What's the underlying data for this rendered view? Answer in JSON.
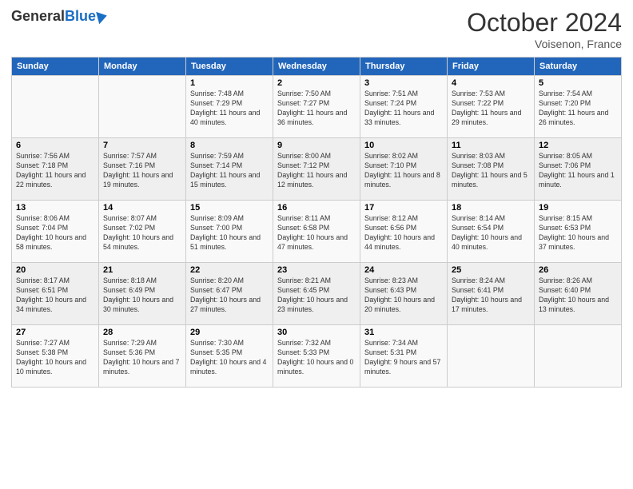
{
  "header": {
    "logo_general": "General",
    "logo_blue": "Blue",
    "month": "October 2024",
    "location": "Voisenon, France"
  },
  "days_of_week": [
    "Sunday",
    "Monday",
    "Tuesday",
    "Wednesday",
    "Thursday",
    "Friday",
    "Saturday"
  ],
  "weeks": [
    [
      {
        "day": "",
        "sunrise": "",
        "sunset": "",
        "daylight": ""
      },
      {
        "day": "",
        "sunrise": "",
        "sunset": "",
        "daylight": ""
      },
      {
        "day": "1",
        "sunrise": "Sunrise: 7:48 AM",
        "sunset": "Sunset: 7:29 PM",
        "daylight": "Daylight: 11 hours and 40 minutes."
      },
      {
        "day": "2",
        "sunrise": "Sunrise: 7:50 AM",
        "sunset": "Sunset: 7:27 PM",
        "daylight": "Daylight: 11 hours and 36 minutes."
      },
      {
        "day": "3",
        "sunrise": "Sunrise: 7:51 AM",
        "sunset": "Sunset: 7:24 PM",
        "daylight": "Daylight: 11 hours and 33 minutes."
      },
      {
        "day": "4",
        "sunrise": "Sunrise: 7:53 AM",
        "sunset": "Sunset: 7:22 PM",
        "daylight": "Daylight: 11 hours and 29 minutes."
      },
      {
        "day": "5",
        "sunrise": "Sunrise: 7:54 AM",
        "sunset": "Sunset: 7:20 PM",
        "daylight": "Daylight: 11 hours and 26 minutes."
      }
    ],
    [
      {
        "day": "6",
        "sunrise": "Sunrise: 7:56 AM",
        "sunset": "Sunset: 7:18 PM",
        "daylight": "Daylight: 11 hours and 22 minutes."
      },
      {
        "day": "7",
        "sunrise": "Sunrise: 7:57 AM",
        "sunset": "Sunset: 7:16 PM",
        "daylight": "Daylight: 11 hours and 19 minutes."
      },
      {
        "day": "8",
        "sunrise": "Sunrise: 7:59 AM",
        "sunset": "Sunset: 7:14 PM",
        "daylight": "Daylight: 11 hours and 15 minutes."
      },
      {
        "day": "9",
        "sunrise": "Sunrise: 8:00 AM",
        "sunset": "Sunset: 7:12 PM",
        "daylight": "Daylight: 11 hours and 12 minutes."
      },
      {
        "day": "10",
        "sunrise": "Sunrise: 8:02 AM",
        "sunset": "Sunset: 7:10 PM",
        "daylight": "Daylight: 11 hours and 8 minutes."
      },
      {
        "day": "11",
        "sunrise": "Sunrise: 8:03 AM",
        "sunset": "Sunset: 7:08 PM",
        "daylight": "Daylight: 11 hours and 5 minutes."
      },
      {
        "day": "12",
        "sunrise": "Sunrise: 8:05 AM",
        "sunset": "Sunset: 7:06 PM",
        "daylight": "Daylight: 11 hours and 1 minute."
      }
    ],
    [
      {
        "day": "13",
        "sunrise": "Sunrise: 8:06 AM",
        "sunset": "Sunset: 7:04 PM",
        "daylight": "Daylight: 10 hours and 58 minutes."
      },
      {
        "day": "14",
        "sunrise": "Sunrise: 8:07 AM",
        "sunset": "Sunset: 7:02 PM",
        "daylight": "Daylight: 10 hours and 54 minutes."
      },
      {
        "day": "15",
        "sunrise": "Sunrise: 8:09 AM",
        "sunset": "Sunset: 7:00 PM",
        "daylight": "Daylight: 10 hours and 51 minutes."
      },
      {
        "day": "16",
        "sunrise": "Sunrise: 8:11 AM",
        "sunset": "Sunset: 6:58 PM",
        "daylight": "Daylight: 10 hours and 47 minutes."
      },
      {
        "day": "17",
        "sunrise": "Sunrise: 8:12 AM",
        "sunset": "Sunset: 6:56 PM",
        "daylight": "Daylight: 10 hours and 44 minutes."
      },
      {
        "day": "18",
        "sunrise": "Sunrise: 8:14 AM",
        "sunset": "Sunset: 6:54 PM",
        "daylight": "Daylight: 10 hours and 40 minutes."
      },
      {
        "day": "19",
        "sunrise": "Sunrise: 8:15 AM",
        "sunset": "Sunset: 6:53 PM",
        "daylight": "Daylight: 10 hours and 37 minutes."
      }
    ],
    [
      {
        "day": "20",
        "sunrise": "Sunrise: 8:17 AM",
        "sunset": "Sunset: 6:51 PM",
        "daylight": "Daylight: 10 hours and 34 minutes."
      },
      {
        "day": "21",
        "sunrise": "Sunrise: 8:18 AM",
        "sunset": "Sunset: 6:49 PM",
        "daylight": "Daylight: 10 hours and 30 minutes."
      },
      {
        "day": "22",
        "sunrise": "Sunrise: 8:20 AM",
        "sunset": "Sunset: 6:47 PM",
        "daylight": "Daylight: 10 hours and 27 minutes."
      },
      {
        "day": "23",
        "sunrise": "Sunrise: 8:21 AM",
        "sunset": "Sunset: 6:45 PM",
        "daylight": "Daylight: 10 hours and 23 minutes."
      },
      {
        "day": "24",
        "sunrise": "Sunrise: 8:23 AM",
        "sunset": "Sunset: 6:43 PM",
        "daylight": "Daylight: 10 hours and 20 minutes."
      },
      {
        "day": "25",
        "sunrise": "Sunrise: 8:24 AM",
        "sunset": "Sunset: 6:41 PM",
        "daylight": "Daylight: 10 hours and 17 minutes."
      },
      {
        "day": "26",
        "sunrise": "Sunrise: 8:26 AM",
        "sunset": "Sunset: 6:40 PM",
        "daylight": "Daylight: 10 hours and 13 minutes."
      }
    ],
    [
      {
        "day": "27",
        "sunrise": "Sunrise: 7:27 AM",
        "sunset": "Sunset: 5:38 PM",
        "daylight": "Daylight: 10 hours and 10 minutes."
      },
      {
        "day": "28",
        "sunrise": "Sunrise: 7:29 AM",
        "sunset": "Sunset: 5:36 PM",
        "daylight": "Daylight: 10 hours and 7 minutes."
      },
      {
        "day": "29",
        "sunrise": "Sunrise: 7:30 AM",
        "sunset": "Sunset: 5:35 PM",
        "daylight": "Daylight: 10 hours and 4 minutes."
      },
      {
        "day": "30",
        "sunrise": "Sunrise: 7:32 AM",
        "sunset": "Sunset: 5:33 PM",
        "daylight": "Daylight: 10 hours and 0 minutes."
      },
      {
        "day": "31",
        "sunrise": "Sunrise: 7:34 AM",
        "sunset": "Sunset: 5:31 PM",
        "daylight": "Daylight: 9 hours and 57 minutes."
      },
      {
        "day": "",
        "sunrise": "",
        "sunset": "",
        "daylight": ""
      },
      {
        "day": "",
        "sunrise": "",
        "sunset": "",
        "daylight": ""
      }
    ]
  ]
}
